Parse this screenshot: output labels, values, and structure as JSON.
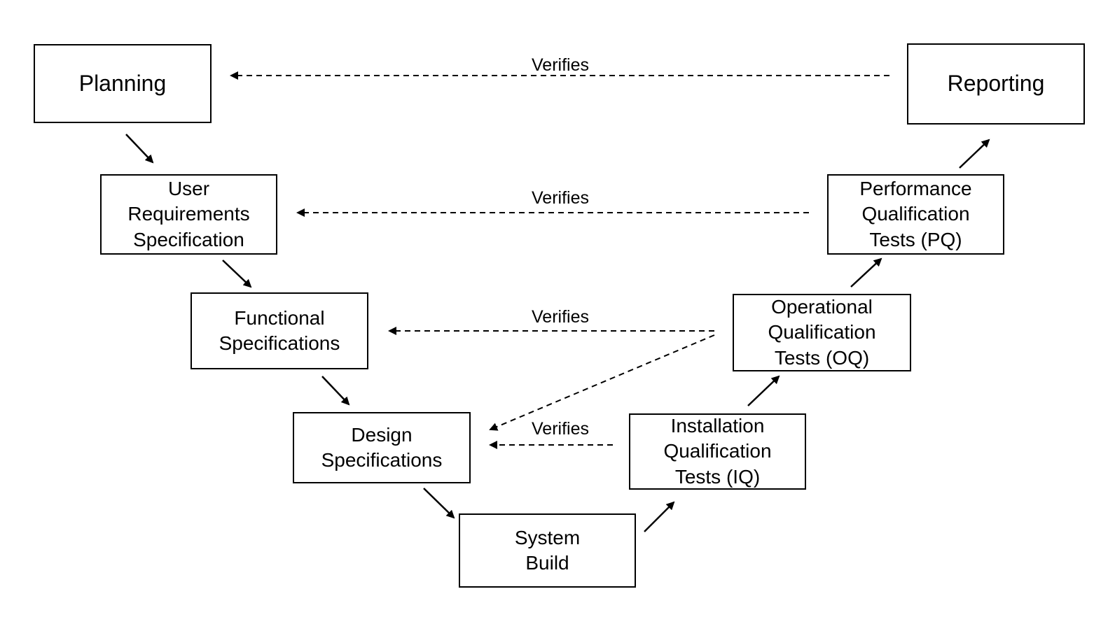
{
  "boxes": {
    "planning": "Planning",
    "urs": "User\nRequirements\nSpecification",
    "fs": "Functional\nSpecifications",
    "ds": "Design\nSpecifications",
    "sb": "System\nBuild",
    "iq": "Installation\nQualification\nTests (IQ)",
    "oq": "Operational\nQualification\nTests (OQ)",
    "pq": "Performance\nQualification\nTests (PQ)",
    "reporting": "Reporting"
  },
  "labels": {
    "verify1": "Verifies",
    "verify2": "Verifies",
    "verify3": "Verifies",
    "verify4": "Verifies"
  }
}
